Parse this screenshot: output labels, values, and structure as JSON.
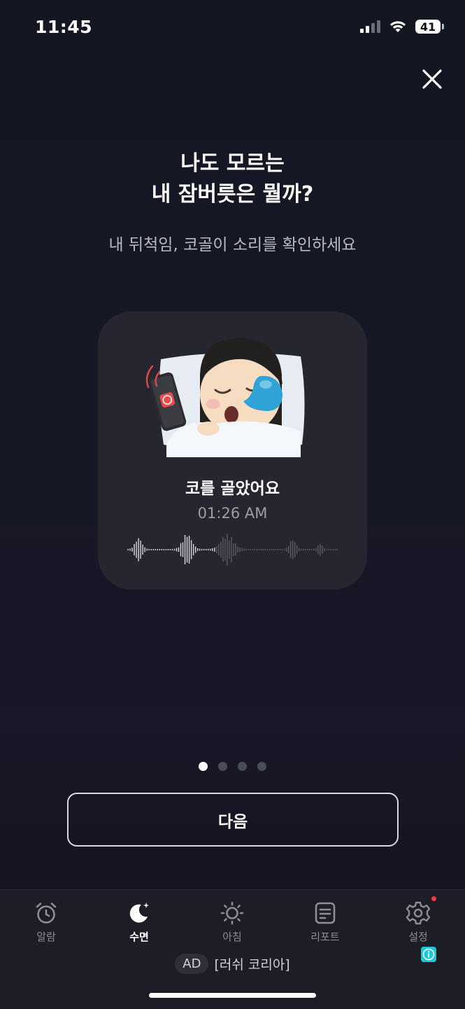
{
  "status_bar": {
    "time": "11:45",
    "battery": "41"
  },
  "onboarding": {
    "title_line1": "나도 모르는",
    "title_line2": "내 잠버릇은 뭘까?",
    "subtitle": "내 뒤척임, 코골이 소리를 확인하세요",
    "card": {
      "event_title": "코를 골았어요",
      "event_time": "01:26 AM"
    },
    "pagination": {
      "total": 4,
      "current": 1
    },
    "next_label": "다음"
  },
  "tabbar": {
    "items": [
      {
        "label": "알람",
        "icon": "alarm-clock-icon"
      },
      {
        "label": "수면",
        "icon": "moon-stars-icon"
      },
      {
        "label": "아침",
        "icon": "sun-icon"
      },
      {
        "label": "리포트",
        "icon": "report-icon"
      },
      {
        "label": "설정",
        "icon": "gear-icon"
      }
    ],
    "active": "수면"
  },
  "ad": {
    "badge": "AD",
    "text": "[러쉬 코리아]"
  },
  "colors": {
    "accent_red": "#ff3b3b",
    "info_badge": "#20c5d8"
  }
}
